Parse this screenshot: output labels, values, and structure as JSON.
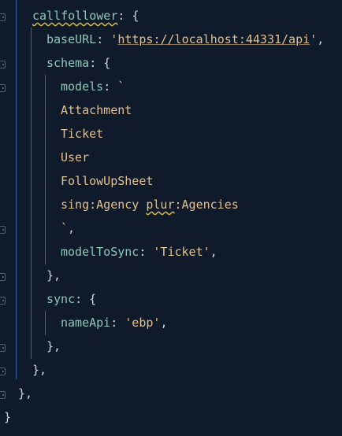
{
  "editor": {
    "lines": {
      "l1": {
        "key": "callfollower",
        "sep": ": {"
      },
      "l2": {
        "key": "baseURL",
        "sep": ": ",
        "q1": "'",
        "url": "https://localhost:44331/api",
        "q2": "'",
        "tail": ","
      },
      "l3": {
        "key": "schema",
        "sep": ": {"
      },
      "l4": {
        "key": "models",
        "sep": ": ",
        "tick": "`"
      },
      "l5": {
        "text": "Attachment"
      },
      "l6": {
        "text": "Ticket"
      },
      "l7": {
        "text": "User"
      },
      "l8": {
        "text": "FollowUpSheet"
      },
      "l9": {
        "a": "sing:Agency ",
        "b": "plur",
        "c": ":Agencies"
      },
      "l10": {
        "tick": "`",
        "tail": ","
      },
      "l11": {
        "key": "modelToSync",
        "sep": ": ",
        "val": "'Ticket'",
        "tail": ","
      },
      "l12": {
        "text": "},"
      },
      "l13": {
        "key": "sync",
        "sep": ": {"
      },
      "l14": {
        "key": "nameApi",
        "sep": ": ",
        "val": "'ebp'",
        "tail": ","
      },
      "l15": {
        "text": "},"
      },
      "l16": {
        "text": "},"
      },
      "l17": {
        "text": "},"
      },
      "l18": {
        "text": "}"
      }
    }
  },
  "colors": {
    "background": "#0f1a2a",
    "property": "#8fc7bb",
    "string": "#e3c08f",
    "punctuation": "#cfd6df",
    "indent_guide": "#2d6aa3",
    "warning_squiggle": "#d6b94a"
  },
  "icons": [
    "fold-marker-icon"
  ]
}
